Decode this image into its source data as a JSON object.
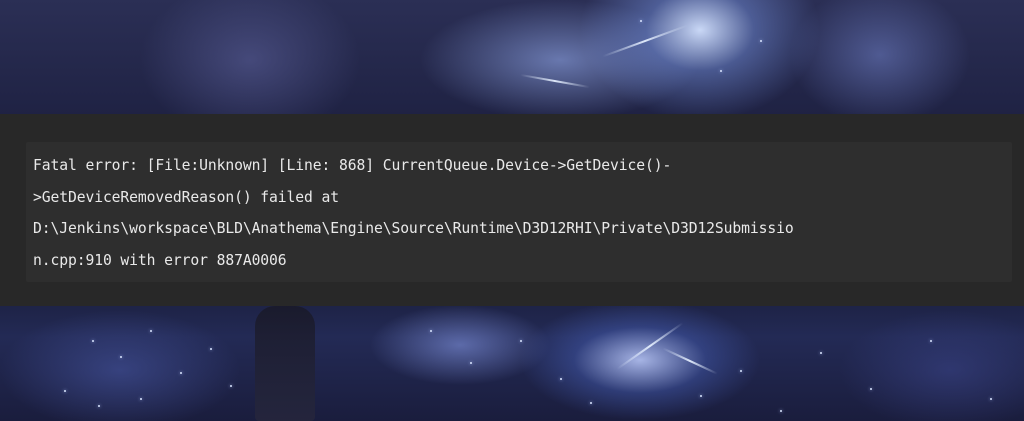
{
  "error": {
    "lines": [
      "Fatal error: [File:Unknown] [Line: 868] CurrentQueue.Device->GetDevice()-",
      ">GetDeviceRemovedReason() failed at",
      "D:\\Jenkins\\workspace\\BLD\\Anathema\\Engine\\Source\\Runtime\\D3D12RHI\\Private\\D3D12Submissio",
      "n.cpp:910 with error 887A0006"
    ]
  },
  "colors": {
    "overlay_background": "#282828",
    "code_background": "#2e2e2e",
    "text": "#e9e9e9",
    "scene_accent": "#9fb4ff"
  }
}
